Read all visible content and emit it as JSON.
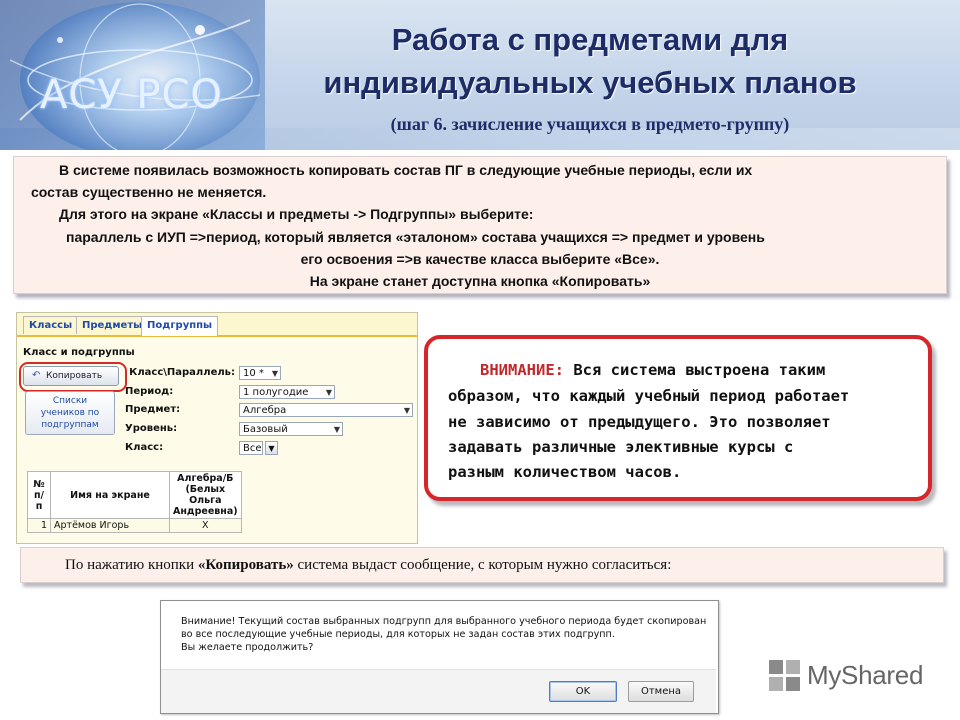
{
  "header": {
    "logo_text": "АСУ РСО",
    "title_line1": "Работа с предметами для",
    "title_line2": "индивидуальных учебных планов",
    "subtitle": "(шаг 6. зачисление учащихся в предмето-группу)"
  },
  "info": {
    "line1": "В системе появилась возможность копировать состав ПГ в следующие учебные периоды, если их",
    "line2": "состав существенно не меняется.",
    "line3": "Для этого на экране «Классы и предметы -> Подгруппы» выберите:",
    "line4": "параллель с ИУП =>период, который является «эталоном» состава учащихся => предмет и уровень",
    "line5": "его освоения =>в качестве класса выберите «Все».",
    "line6": "На экране станет доступна кнопка «Копировать»"
  },
  "app": {
    "tabs": [
      "Классы",
      "Предметы",
      "Подгруппы"
    ],
    "active_tab": "Подгруппы",
    "heading": "Класс и подгруппы",
    "copy_button": "Копировать",
    "lists_button_l1": "Списки",
    "lists_button_l2": "учеников по",
    "lists_button_l3": "подгруппам",
    "form": {
      "parallel_label": "Класс\\Параллель:",
      "parallel_value": "10 *",
      "period_label": "Период:",
      "period_value": "1 полугодие",
      "subject_label": "Предмет:",
      "subject_value": "Алгебра",
      "level_label": "Уровень:",
      "level_value": "Базовый",
      "class_label": "Класс:",
      "class_value": "Все"
    },
    "table": {
      "col_num_l1": "№",
      "col_num_l2": "п/п",
      "col_name": "Имя на экране",
      "col_group_l1": "Алгебра/Б",
      "col_group_l2": "(Белых",
      "col_group_l3": "Ольга",
      "col_group_l4": "Андреевна)",
      "rows": [
        {
          "num": "1",
          "name": "Артёмов Игорь",
          "mark": "X"
        }
      ]
    }
  },
  "attention": {
    "head": "ВНИМАНИЕ:",
    "line1_rest": " Вся система выстроена таким",
    "line2": "образом, что каждый учебный период работает",
    "line3": "не зависимо от предыдущего. Это позволяет",
    "line4": "задавать различные элективные курсы с",
    "line5": "разным количеством часов."
  },
  "note": {
    "prefix": "По нажатию кнопки ",
    "bold": "«Копировать»",
    "suffix": " система выдаст сообщение, с которым нужно согласиться:"
  },
  "dialog": {
    "line1": "Внимание! Текущий состав выбранных подгрупп для выбранного учебного периода будет скопирован",
    "line2": "во все последующие учебные периоды, для которых не задан состав этих подгрупп.",
    "line3": "Вы желаете продолжить?",
    "ok": "OK",
    "cancel": "Отмена"
  },
  "watermark": "MyShared",
  "colors": {
    "title": "#1d2c66",
    "attention_border": "#d7262a",
    "attention_head": "#c0282c",
    "info_bg": "#fdf0ea",
    "tab_text": "#1f4aa8"
  }
}
